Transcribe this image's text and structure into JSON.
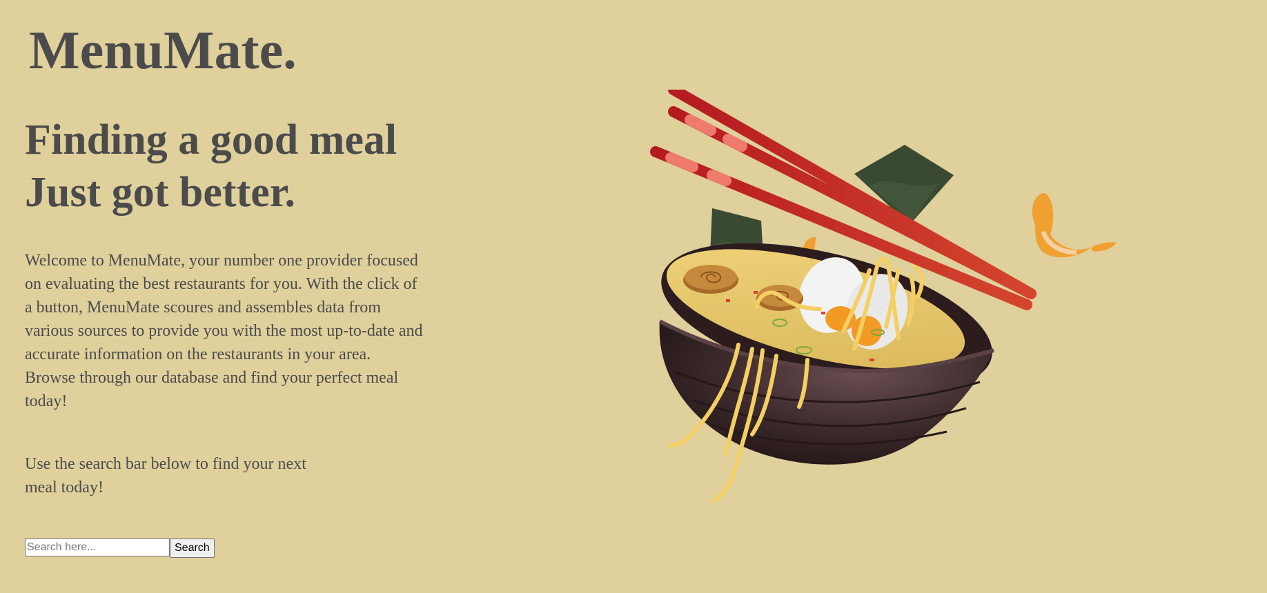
{
  "page": {
    "background_color": "#dfd09c",
    "text_color": "#4b4b4b"
  },
  "header": {
    "logo": "MenuMate."
  },
  "hero": {
    "headline_line1": "Finding a good meal",
    "headline_line2": "Just got better.",
    "intro": "Welcome to MenuMate, your number one provider focused on evaluating the best restaurants for you. With the click of a button, MenuMate scoures and assembles data from various sources to provide you with the most up-to-date and accurate information on the restaurants in your area. Browse through our database and find your perfect meal today!",
    "cta": "Use the search bar below to find your next meal today!"
  },
  "search": {
    "placeholder": "Search here...",
    "value": "",
    "button_label": "Search"
  },
  "illustration": {
    "name": "ramen-bowl-illustration",
    "elements": [
      "chopsticks",
      "nori-sheet",
      "shrimp",
      "bowl",
      "noodles",
      "boiled-egg",
      "narutomaki"
    ],
    "colors": {
      "bowl": "#3d2a2c",
      "chopsticks": "#c0302a",
      "chopstick_stripe": "#ee7b6d",
      "nori": "#3a4a32",
      "broth": "#e7c86a",
      "noodles": "#f4cf63",
      "shrimp": "#f0a030",
      "egg_white": "#f3f3f3",
      "egg_yolk": "#f29a24"
    }
  }
}
